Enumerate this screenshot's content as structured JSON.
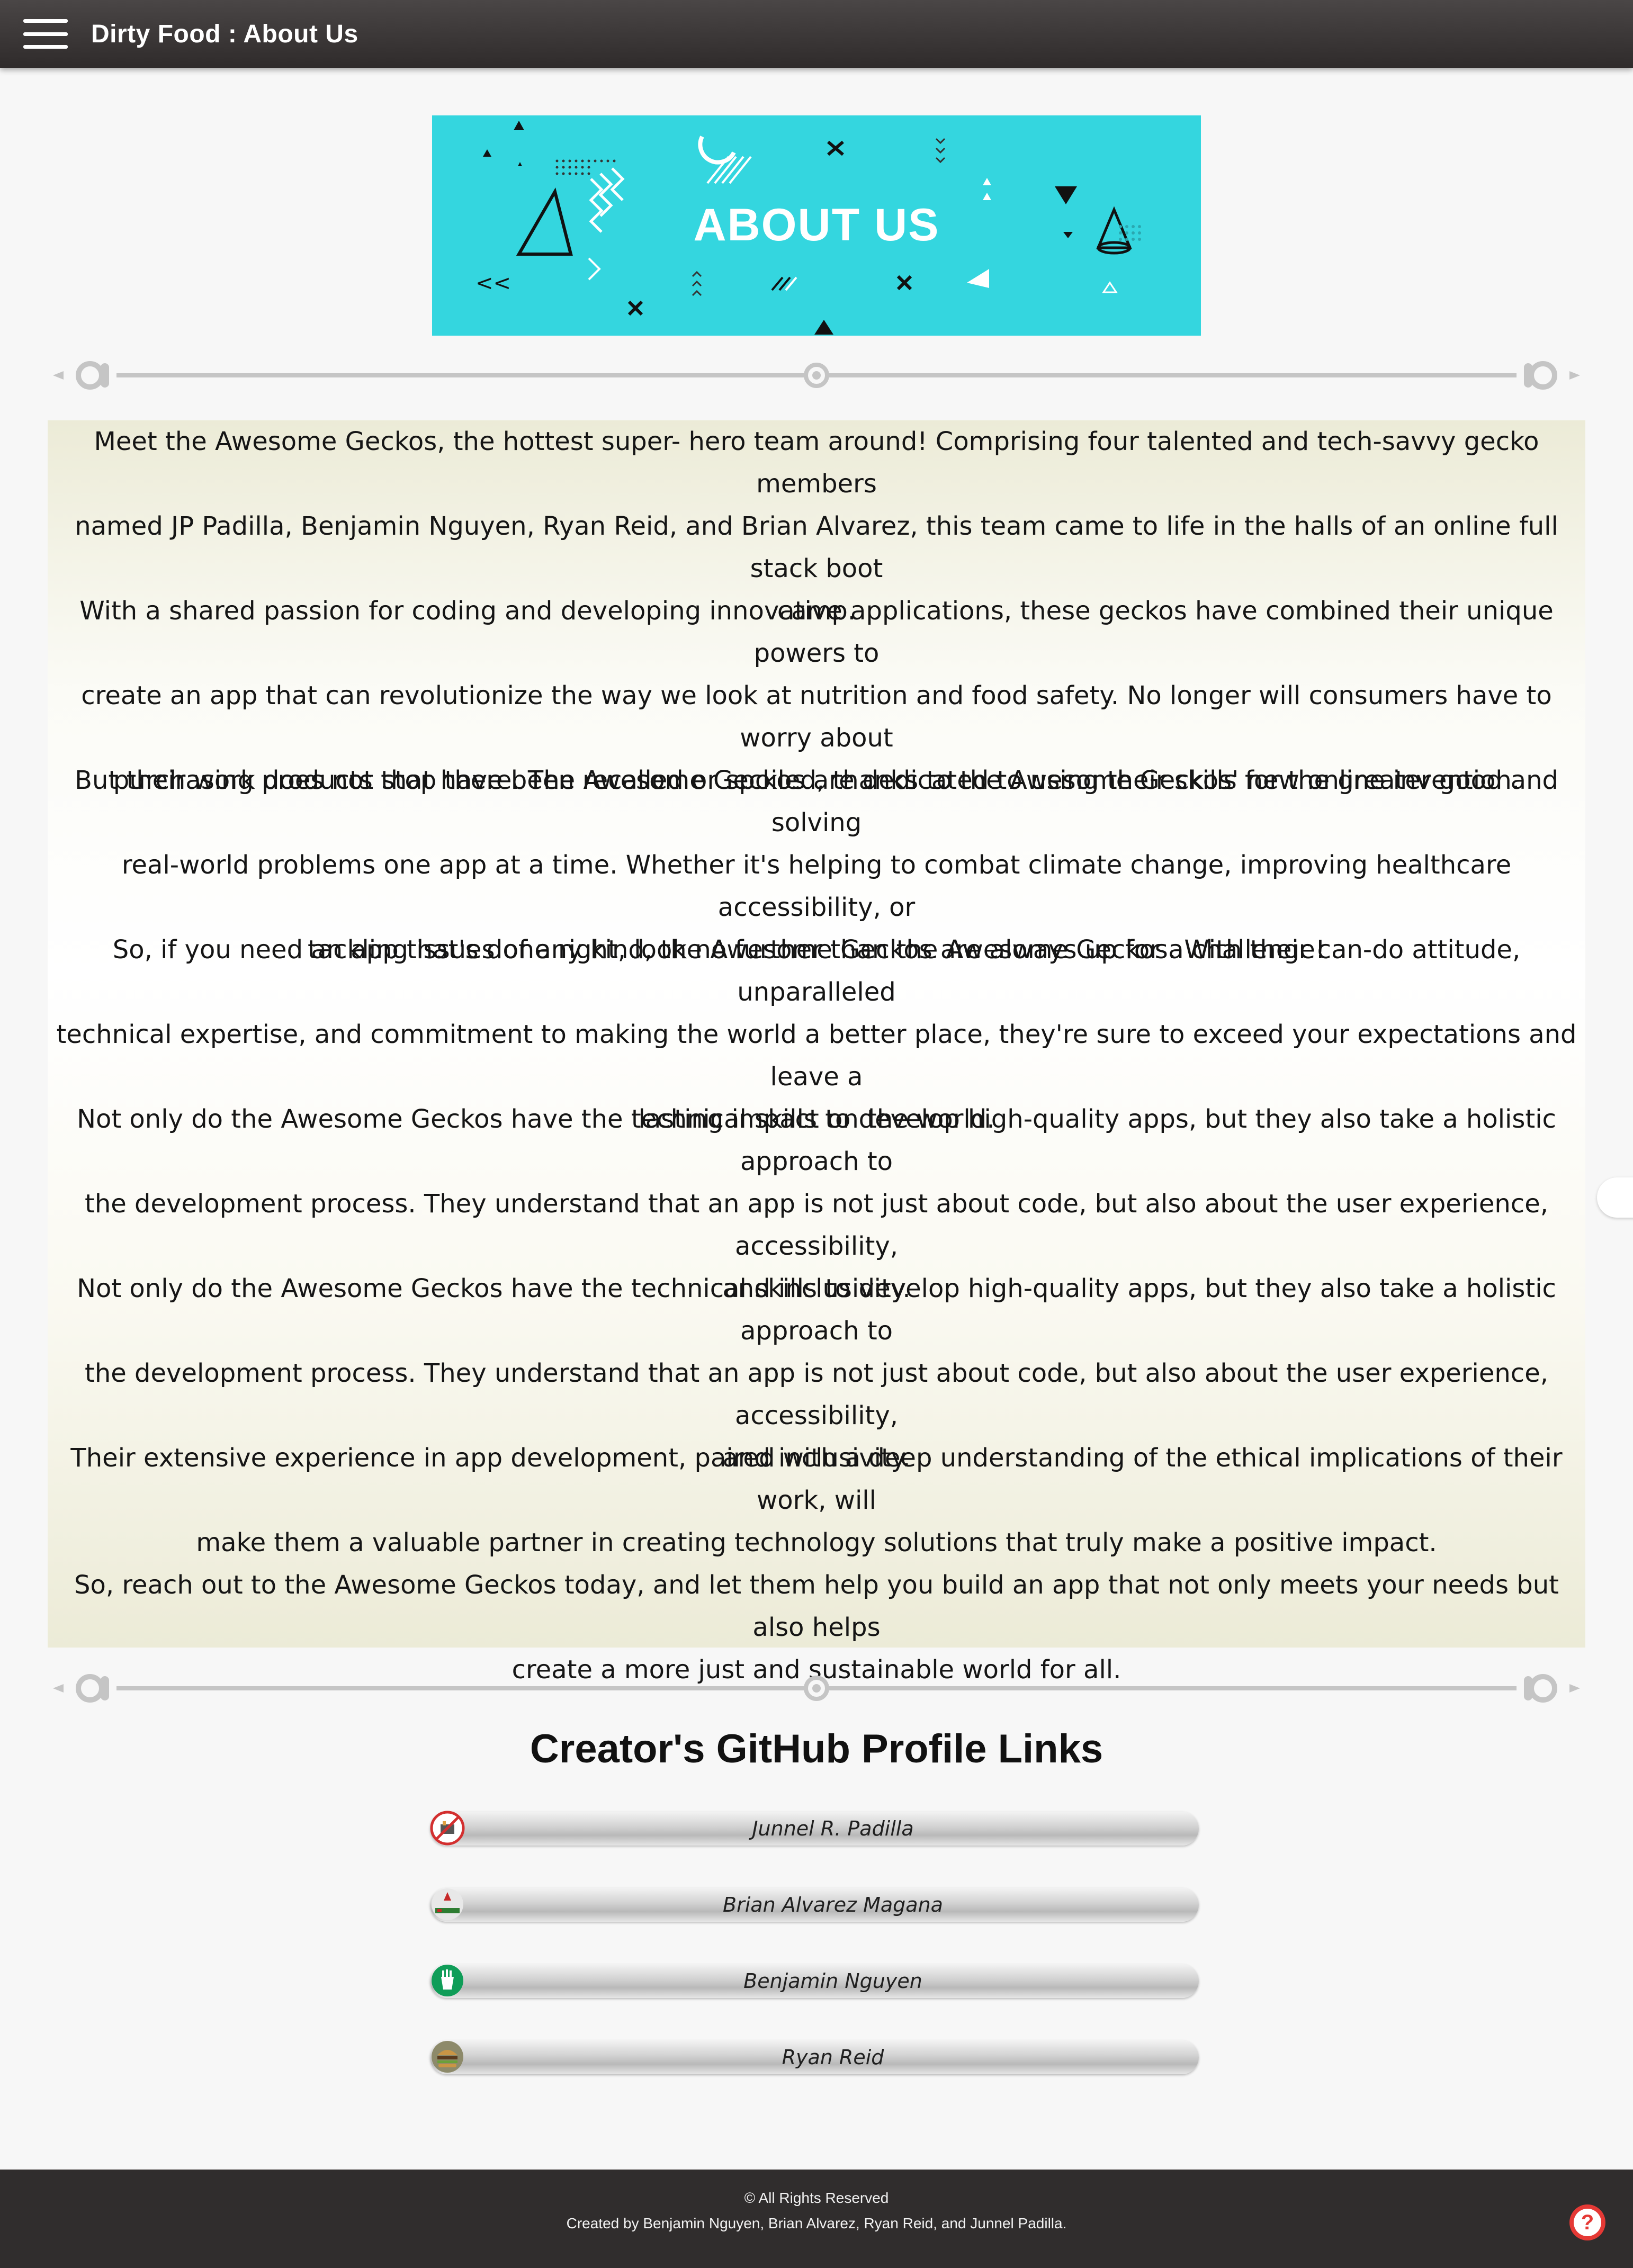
{
  "appbar": {
    "title": "Dirty Food : About Us",
    "menu_icon": "hamburger-menu-icon"
  },
  "banner": {
    "title": "ABOUT US",
    "background": "#34d6df"
  },
  "about": {
    "paragraphs": [
      [
        "Meet the Awesome Geckos, the hottest super- hero team around! Comprising four talented and tech-savvy gecko members",
        "named JP Padilla, Benjamin Nguyen, Ryan Reid, and Brian Alvarez, this team came to life in the halls of an online full stack boot",
        "camp."
      ],
      [
        "With a shared passion for coding and developing innovative applications, these geckos have combined their unique powers to",
        "create an app that can revolutionize the way we look at nutrition and food safety. No longer will consumers have to worry about",
        "purchasing products that have been recalled or spoiled, thanks to the Awesome Geckos' new online invention."
      ],
      [
        "But their work does not stop there. The Awesome Geckos are dedicated to using their skills for the greater good and solving",
        "real-world problems one app at a time. Whether it's helping to combat climate change, improving healthcare accessibility, or",
        "tackling issues of any kind, the Awesome Geckos are always up for a challenge!"
      ],
      [
        "So, if you need an app that's done right, look no further than the Awesome Geckos. With their can-do attitude, unparalleled",
        "technical expertise, and commitment to making the world a better place, they're sure to exceed your expectations and leave a",
        "lasting impact on the world."
      ],
      [
        "Not only do the Awesome Geckos have the technical skills to develop high-quality apps, but they also take a holistic approach to",
        "the development process. They understand that an app is not just about code, but also about the user experience, accessibility,",
        "and inclusivity."
      ],
      [
        "Not only do the Awesome Geckos have the technical skills to develop high-quality apps, but they also take a holistic approach to",
        "the development process. They understand that an app is not just about code, but also about the user experience, accessibility,",
        "and inclusivity."
      ],
      [
        "Their extensive experience in app development, paired with a deep understanding of the ethical implications of their work, will",
        "make them a valuable partner in creating technology solutions that truly make a positive impact."
      ],
      [
        "So, reach out to the Awesome Geckos today, and let them help you build an app that not only meets your needs but also helps",
        "create a more just and sustainable world for all."
      ]
    ]
  },
  "github": {
    "heading": "Creator's GitHub Profile Links",
    "profiles": [
      {
        "name": "Junnel R. Padilla",
        "icon": "no-junk-food-avatar-icon"
      },
      {
        "name": "Brian Alvarez Magana",
        "icon": "food-logo-avatar-icon"
      },
      {
        "name": "Benjamin Nguyen",
        "icon": "green-fries-avatar-icon"
      },
      {
        "name": "Ryan Reid",
        "icon": "burger-avatar-icon"
      }
    ]
  },
  "footer": {
    "rights": "© All Rights Reserved",
    "credits": "Created by Benjamin Nguyen, Brian Alvarez, Ryan Reid, and Junnel Padilla.",
    "help_icon": "help-question-icon"
  },
  "colors": {
    "appbar": "#3a3636",
    "banner": "#34d6df",
    "footer": "#302d2d",
    "help": "#e53935"
  }
}
